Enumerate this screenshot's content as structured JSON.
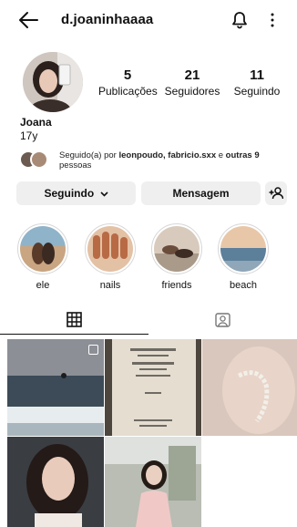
{
  "header": {
    "username": "d.joaninhaaaa",
    "back_icon": "arrow-left-icon",
    "bell_icon": "bell-icon",
    "more_icon": "more-vertical-icon"
  },
  "profile": {
    "name": "Joana",
    "bio": "17y",
    "stats": [
      {
        "value": "5",
        "label": "Publicações"
      },
      {
        "value": "21",
        "label": "Seguidores"
      },
      {
        "value": "11",
        "label": "Seguindo"
      }
    ]
  },
  "mutual": {
    "prefix": "Seguido(a) por ",
    "names": "leonpoudo, fabricio.sxx",
    "middle": " e ",
    "others": "outras 9",
    "suffix": " pessoas"
  },
  "actions": {
    "following_label": "Seguindo",
    "message_label": "Mensagem",
    "add_icon": "add-person-icon"
  },
  "highlights": [
    {
      "label": "ele"
    },
    {
      "label": "nails"
    },
    {
      "label": "friends"
    },
    {
      "label": "beach"
    }
  ],
  "tabs": {
    "grid_icon": "grid-icon",
    "tagged_icon": "tagged-icon"
  },
  "colors": {
    "text": "#111111",
    "button_bg": "#efefef",
    "border": "#d7d7d7"
  }
}
